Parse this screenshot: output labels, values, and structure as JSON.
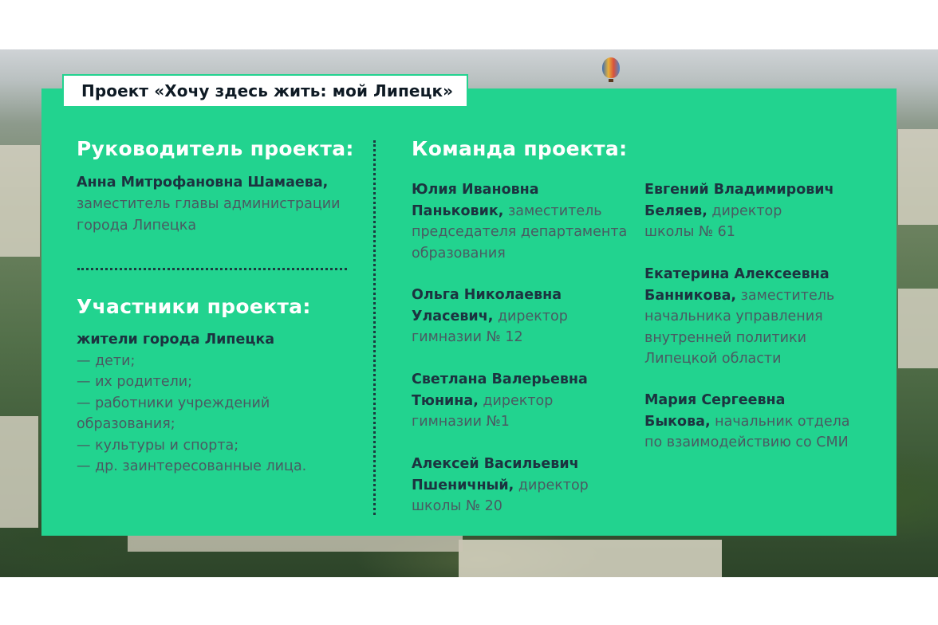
{
  "slide": {
    "title": "Проект «Хочу здесь жить: мой Липецк»",
    "left": {
      "leader_heading": "Руководитель проекта:",
      "leader_name": "Анна Митрофановна Шамаева,",
      "leader_role_1": "заместитель главы администрации",
      "leader_role_2": "города Липецка",
      "participants_heading": "Участники проекта:",
      "participants_intro": "жители города Липецка",
      "participants": [
        "— дети;",
        "— их родители;",
        "— работники учреждений",
        "образования;",
        "— культуры и спорта;",
        "— др. заинтересованные лица."
      ]
    },
    "team": {
      "heading": "Команда проекта:",
      "members": [
        {
          "name_1": "Юлия Ивановна",
          "name_2": "Паньковик,",
          "role_1": " заместитель",
          "role_2": "председателя департамента",
          "role_3": "образования"
        },
        {
          "name_1": "Ольга Николаевна",
          "name_2": "Уласевич,",
          "role_1": " директор",
          "role_2": "гимназии № 12"
        },
        {
          "name_1": "Светлана Валерьевна",
          "name_2": "Тюнина,",
          "role_1": " директор",
          "role_2": "гимназии №1"
        },
        {
          "name_1": "Алексей Васильевич",
          "name_2": "Пшеничный,",
          "role_1": " директор",
          "role_2": "школы № 20"
        },
        {
          "name_1": "Евгений Владимирович",
          "name_2": "Беляев,",
          "role_1": " директор",
          "role_2": "школы № 61"
        },
        {
          "name_1": "Екатерина Алексеевна",
          "name_2": "Банникова,",
          "role_1": " заместитель",
          "role_2": "начальника управления",
          "role_3": "внутренней политики",
          "role_4": "Липецкой области"
        },
        {
          "name_1": "Мария Сергеевна",
          "name_2": "Быкова,",
          "role_1": " начальник отдела",
          "role_2": "по взаимодействию со СМИ"
        }
      ]
    }
  }
}
